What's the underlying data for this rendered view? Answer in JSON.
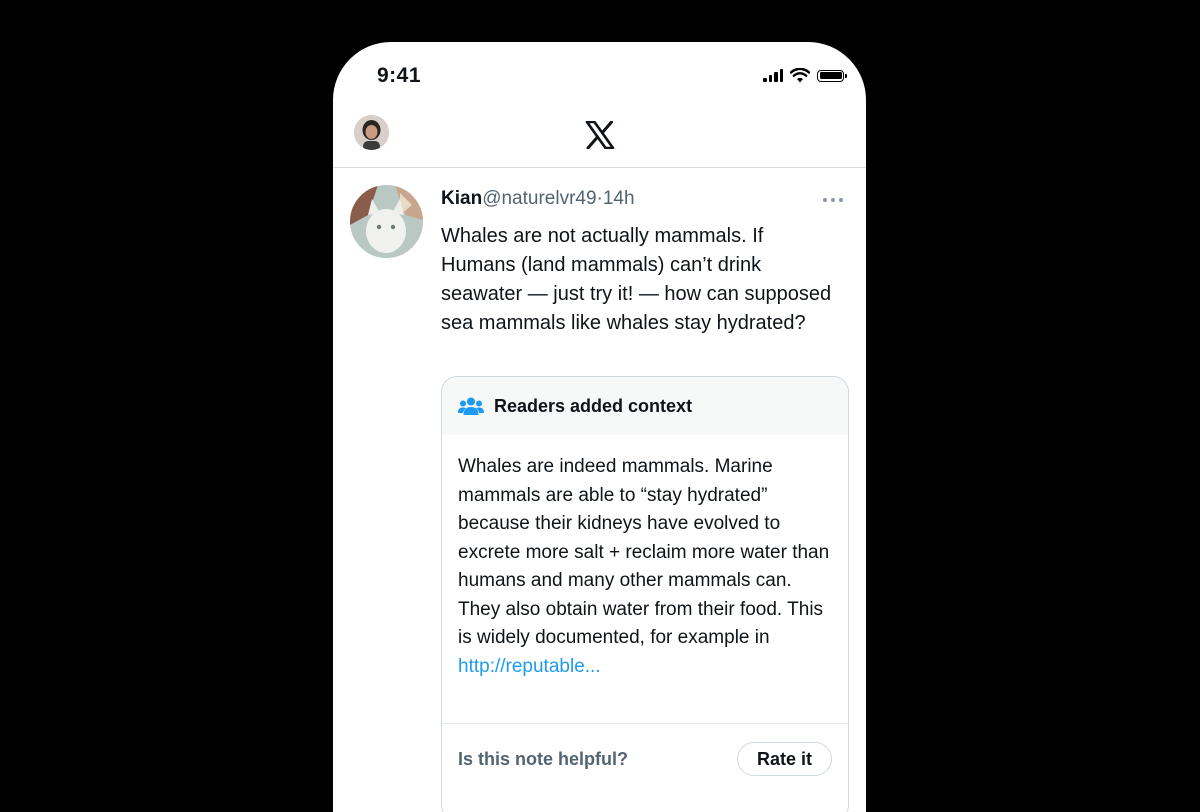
{
  "status_bar": {
    "time": "9:41"
  },
  "header": {
    "logo": "x-logo"
  },
  "tweet": {
    "name": "Kian",
    "handle": "@naturelvr49",
    "separator": "·",
    "time": "14h",
    "text": "Whales are not actually mammals. If Humans (land mammals) can’t drink seawater — just try it! — how can supposed sea mammals like whales stay hydrated?"
  },
  "note": {
    "title": "Readers added context",
    "icon": "people-icon",
    "body": "Whales are indeed mammals. Marine mammals are able to “stay hydrated” because their kidneys have evolved to excrete more salt + reclaim more water than humans and many other mammals can. They also obtain water from their food. This is widely documented, for example in ",
    "link": "http://reputable...",
    "question": "Is this note helpful?",
    "rate_label": "Rate it"
  },
  "colors": {
    "accent": "#1d9bf0",
    "note_header_bg": "#f7f9f9",
    "muted_text": "#536471"
  }
}
